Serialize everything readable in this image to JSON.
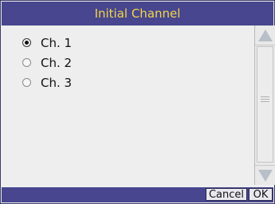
{
  "dialog": {
    "title": "Initial Channel",
    "accent_color": "#47468f",
    "title_color": "#f2d64a"
  },
  "options": [
    {
      "label": "Ch. 1",
      "selected": true
    },
    {
      "label": "Ch. 2",
      "selected": false
    },
    {
      "label": "Ch. 3",
      "selected": false
    }
  ],
  "scrollbar": {
    "up_icon": "triangle-up-icon",
    "down_icon": "triangle-down-icon",
    "grip_icon": "grip-lines-icon"
  },
  "buttons": {
    "cancel_label": "Cancel",
    "ok_label": "OK"
  }
}
